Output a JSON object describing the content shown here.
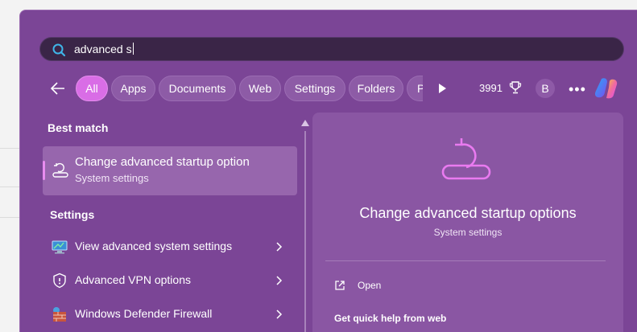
{
  "search": {
    "value": "advanced s"
  },
  "filters": {
    "tabs": [
      {
        "label": "All",
        "active": true
      },
      {
        "label": "Apps"
      },
      {
        "label": "Documents"
      },
      {
        "label": "Web"
      },
      {
        "label": "Settings"
      },
      {
        "label": "Folders"
      },
      {
        "label": "P"
      }
    ],
    "points": "3991",
    "avatar_initial": "B"
  },
  "results": {
    "best_match_heading": "Best match",
    "best_match": {
      "title": "Change advanced startup option",
      "subtitle": "System settings",
      "icon": "startup-recovery-icon"
    },
    "settings_heading": "Settings",
    "settings_items": [
      {
        "label": "View advanced system settings",
        "icon": "system-monitor-icon"
      },
      {
        "label": "Advanced VPN options",
        "icon": "shield-icon"
      },
      {
        "label": "Windows Defender Firewall",
        "icon": "firewall-icon"
      }
    ]
  },
  "detail": {
    "title": "Change advanced startup options",
    "subtitle": "System settings",
    "open_label": "Open",
    "help_label": "Get quick help from web",
    "accent": "#e97af0"
  },
  "colors": {
    "panel": "#7b4596",
    "active_chip": "#d96de6",
    "search_bg": "#3a2547"
  }
}
